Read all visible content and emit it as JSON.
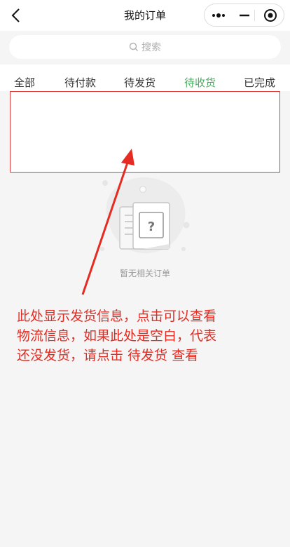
{
  "header": {
    "title": "我的订单"
  },
  "search": {
    "placeholder": "搜索"
  },
  "tabs": [
    {
      "label": "全部"
    },
    {
      "label": "待付款"
    },
    {
      "label": "待发货"
    },
    {
      "label": "待收货",
      "active": true
    },
    {
      "label": "已完成"
    }
  ],
  "empty_state": {
    "text": "暂无相关订单"
  },
  "annotation": {
    "line1": "此处显示发货信息，点击可以查看",
    "line2": "物流信息，如果此处是空白，代表",
    "line3": "还没发货，请点击 待发货 查看"
  },
  "colors": {
    "accent": "#4cae63",
    "annotation": "#e52b22"
  }
}
